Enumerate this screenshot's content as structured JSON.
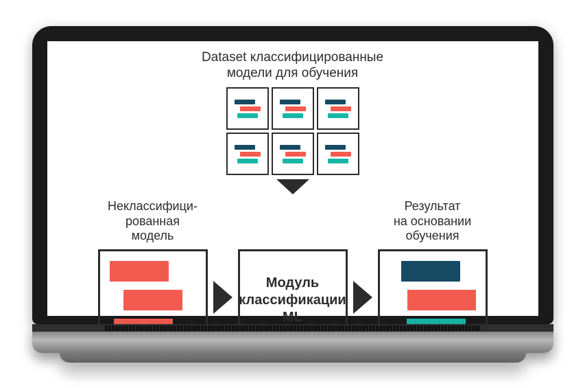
{
  "dataset_title_line1": "Dataset классифицированные",
  "dataset_title_line2": "модели для обучения",
  "input_label_line1": "Неклассифици-",
  "input_label_line2": "рованная",
  "input_label_line3": "модель",
  "module_line1": "Модуль",
  "module_line2": "классификации",
  "module_line3": "ML",
  "result_label_line1": "Результат",
  "result_label_line2": "на основании",
  "result_label_line3": "обучения",
  "colors": {
    "navy": "#164a63",
    "coral": "#f25b50",
    "teal": "#18b6a6"
  }
}
